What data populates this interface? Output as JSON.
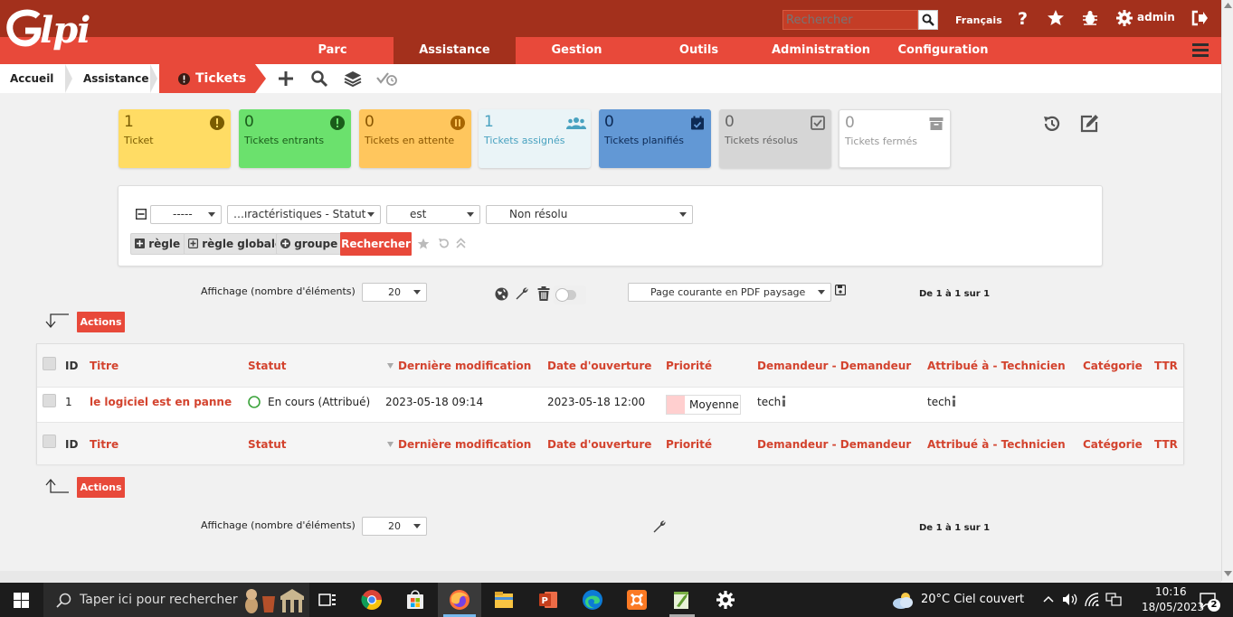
{
  "header": {
    "logo_text": "lpi",
    "search_placeholder": "Rechercher",
    "language": "Français",
    "user": "admin"
  },
  "menu": {
    "items": [
      {
        "label": "Parc"
      },
      {
        "label": "Assistance"
      },
      {
        "label": "Gestion"
      },
      {
        "label": "Outils"
      },
      {
        "label": "Administration"
      },
      {
        "label": "Configuration"
      }
    ]
  },
  "breadcrumb": {
    "home": "Accueil",
    "section": "Assistance",
    "current": "Tickets"
  },
  "tiles": [
    {
      "count": "1",
      "label": "Ticket",
      "bg": "#ffdc64",
      "fg": "#7a5c00"
    },
    {
      "count": "0",
      "label": "Tickets entrants",
      "bg": "#6be16d",
      "fg": "#1a5c1a"
    },
    {
      "count": "0",
      "label": "Tickets en attente",
      "bg": "#ffc65d",
      "fg": "#8a5600"
    },
    {
      "count": "1",
      "label": "Tickets assignés",
      "bg": "#eaf4f7",
      "fg": "#49a2c0"
    },
    {
      "count": "0",
      "label": "Tickets planifiés",
      "bg": "#6298d5",
      "fg": "#0d2a55"
    },
    {
      "count": "0",
      "label": "Tickets résolus",
      "bg": "#d6d6d6",
      "fg": "#666666"
    },
    {
      "count": "0",
      "label": "Tickets fermés",
      "bg": "#ffffff",
      "fg": "#999999"
    }
  ],
  "search": {
    "link_select": "-----",
    "field_select": "…ıractéristiques - Statut",
    "operator_select": "est",
    "value_select": "Non résolu",
    "rule_btn": "règle",
    "global_rule_btn": "règle globale",
    "group_btn": "groupe",
    "search_btn": "Rechercher"
  },
  "display": {
    "label": "Affichage (nombre d'éléments)",
    "count": "20",
    "export_select": "Page courante en PDF paysage",
    "pagination": "De 1 à 1 sur 1"
  },
  "actions_label": "Actions",
  "table": {
    "columns": [
      {
        "label": "ID",
        "style": "dark"
      },
      {
        "label": "Titre",
        "style": "red"
      },
      {
        "label": "Statut",
        "style": "red"
      },
      {
        "label": "Dernière modification",
        "style": "red"
      },
      {
        "label": "Date d'ouverture",
        "style": "red"
      },
      {
        "label": "Priorité",
        "style": "red"
      },
      {
        "label": "Demandeur - Demandeur",
        "style": "red"
      },
      {
        "label": "Attribué à - Technicien",
        "style": "red"
      },
      {
        "label": "Catégorie",
        "style": "red"
      },
      {
        "label": "TTR",
        "style": "red"
      }
    ],
    "rows": [
      {
        "id": "1",
        "title": "le logiciel est en panne",
        "status": "En cours (Attribué)",
        "modified": "2023-05-18 09:14",
        "opened": "2023-05-18 12:00",
        "priority": "Moyenne",
        "requester": "tech",
        "technician": "tech"
      }
    ]
  },
  "taskbar": {
    "search_placeholder": "Taper ici pour rechercher",
    "weather": "20°C  Ciel couvert",
    "time": "10:16",
    "date": "18/05/2023",
    "notifications": "2"
  }
}
